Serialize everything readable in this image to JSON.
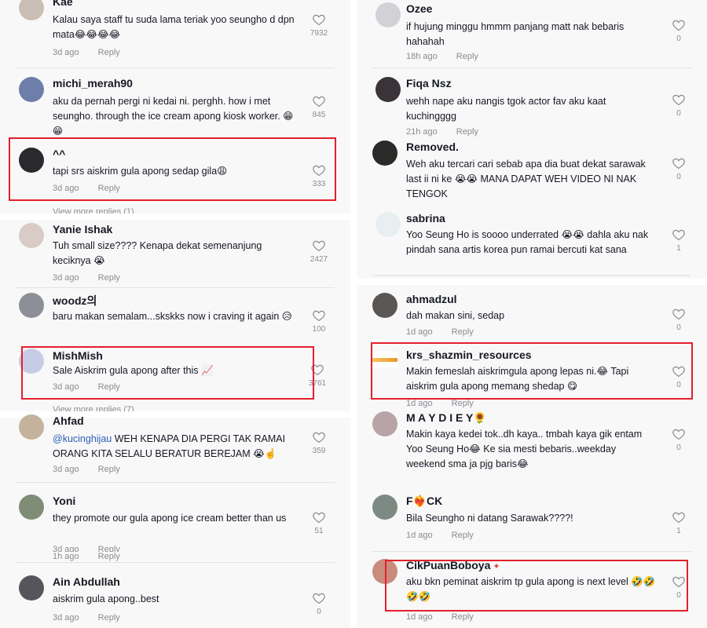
{
  "left": {
    "comments": [
      {
        "user": "Kae",
        "text": "Kalau saya staff tu suda lama teriak yoo seungho d dpn mata😂😂😂😂",
        "time": "3d ago",
        "reply": "Reply",
        "likes": "7932"
      },
      {
        "user": "michi_merah90",
        "text": "aku da pernah pergi ni kedai ni. perghh. how i met seungho. through the ice cream apong kiosk worker. 😁😁",
        "time": "",
        "reply": "",
        "likes": "845"
      },
      {
        "user": "^^",
        "text": "tapi srs aiskrim gula apong sedap gila😩",
        "time": "3d ago",
        "reply": "Reply",
        "likes": "333"
      },
      {
        "user": "Yanie Ishak",
        "text": "Tuh small size???? Kenapa dekat semenanjung keciknya 😭",
        "time": "3d ago",
        "reply": "Reply",
        "likes": "2427"
      },
      {
        "user": "woodz의",
        "text": "baru makan semalam...skskks now i craving it again 😥",
        "time": "",
        "reply": "",
        "likes": "100"
      },
      {
        "user": "MishMish",
        "text": "Sale Aiskrim gula apong after this 📈",
        "time": "3d ago",
        "reply": "Reply",
        "likes": "3761"
      },
      {
        "user": "Ahfad",
        "mention": "@kucinghijau",
        "text": " WEH KENAPA DIA PERGI TAK RAMAI ORANG KITA SELALU BERATUR BEREJAM 😭☝️",
        "time": "3d ago",
        "reply": "Reply",
        "likes": "359"
      },
      {
        "user": "Yoni",
        "text": "they promote our gula apong ice cream better than us",
        "time": "3d ago",
        "reply": "Reply",
        "time2": "1h ago",
        "reply2": "Reply",
        "likes": "51"
      },
      {
        "user": "Ain Abdullah",
        "text": "aiskrim gula apong..best",
        "time": "3d ago",
        "reply": "Reply",
        "likes": "0"
      }
    ],
    "view_more": [
      "View more replies (1)",
      "View more replies (7)"
    ]
  },
  "right": {
    "comments": [
      {
        "user": "Ozee",
        "text": "if hujung minggu hmmm panjang matt nak bebaris hahahah",
        "time": "18h ago",
        "reply": "Reply",
        "likes": "0"
      },
      {
        "user": "Fiqa Nsz",
        "text": "wehh nape aku nangis tgok actor fav aku kaat kuchingggg",
        "time": "21h ago",
        "reply": "Reply",
        "likes": "0"
      },
      {
        "user": "Removed.",
        "text": "Weh aku tercari cari sebab apa dia buat dekat sarawak last ii ni ke 😭😭 MANA DAPAT WEH VIDEO NI NAK TENGOK",
        "time": "",
        "reply": "",
        "likes": "0"
      },
      {
        "user": "sabrina",
        "text": "Yoo Seung Ho is soooo underrated 😭😭 dahla aku nak pindah sana artis korea pun ramai bercuti kat sana",
        "time": "",
        "reply": "",
        "likes": "1"
      },
      {
        "user": "ahmadzul",
        "text": "dah makan sini, sedap",
        "time": "1d ago",
        "reply": "Reply",
        "likes": "0"
      },
      {
        "user": "krs_shazmin_resources",
        "text": "Makin femeslah aiskrimgula apong lepas ni.😂 Tapi aiskrim gula apong memang shedap 😋",
        "time": "1d ago",
        "reply": "Reply",
        "likes": "0"
      },
      {
        "user": "M A Y D I E Y🌻",
        "text": "Makin kaya kedei tok..dh kaya.. tmbah kaya gik entam Yoo Seung Ho😂 Ke sia mesti bebaris..weekday weekend sma ja pjg baris😂",
        "time": "",
        "reply": "",
        "likes": "0"
      },
      {
        "user": "F❤️‍🔥CK",
        "text": "Bila Seungho ni datang Sarawak????!",
        "time": "1d ago",
        "reply": "Reply",
        "likes": "1"
      },
      {
        "user": "CikPuanBoboya",
        "text": "aku bkn peminat aiskrim tp gula apong is next level 🤣🤣🤣🤣",
        "time": "1d ago",
        "reply": "Reply",
        "likes": "0"
      }
    ]
  },
  "colors": {
    "highlight": "#e3202c",
    "mention": "#2b5db9",
    "meta": "#8a8b91"
  }
}
